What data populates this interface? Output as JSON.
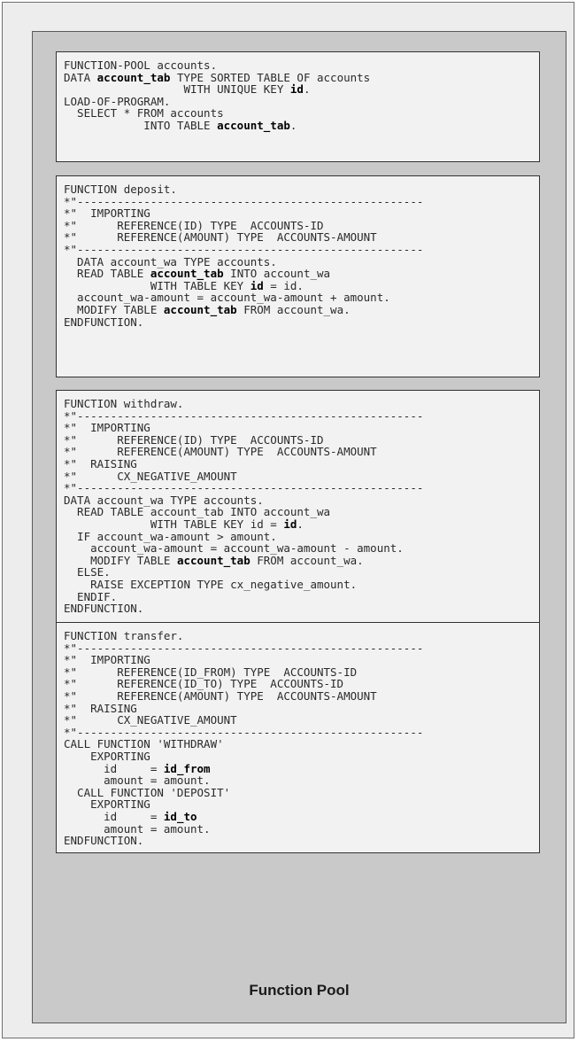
{
  "pool_label": "Function Pool",
  "blocks": [
    {
      "name": "function-pool-header",
      "lines": [
        [
          {
            "t": "FUNCTION-POOL accounts."
          }
        ],
        [
          {
            "t": "DATA "
          },
          {
            "t": "account_tab",
            "b": true
          },
          {
            "t": " TYPE SORTED TABLE OF accounts"
          }
        ],
        [
          {
            "t": "                  WITH UNIQUE KEY "
          },
          {
            "t": "id",
            "b": true
          },
          {
            "t": "."
          }
        ],
        [
          {
            "t": "LOAD-OF-PROGRAM."
          }
        ],
        [
          {
            "t": "  SELECT * FROM accounts"
          }
        ],
        [
          {
            "t": "            INTO TABLE "
          },
          {
            "t": "account_tab",
            "b": true
          },
          {
            "t": "."
          }
        ]
      ]
    },
    {
      "name": "function-deposit",
      "lines": [
        [
          {
            "t": "FUNCTION deposit."
          }
        ],
        [
          {
            "t": "*\"----------------------------------------------------"
          }
        ],
        [
          {
            "t": "*\"  IMPORTING"
          }
        ],
        [
          {
            "t": "*\"      REFERENCE(ID) TYPE  ACCOUNTS-ID"
          }
        ],
        [
          {
            "t": "*\"      REFERENCE(AMOUNT) TYPE  ACCOUNTS-AMOUNT"
          }
        ],
        [
          {
            "t": "*\"----------------------------------------------------"
          }
        ],
        [
          {
            "t": "  DATA account_wa TYPE accounts."
          }
        ],
        [
          {
            "t": "  READ TABLE "
          },
          {
            "t": "account_tab",
            "b": true
          },
          {
            "t": " INTO account_wa"
          }
        ],
        [
          {
            "t": "             WITH TABLE KEY "
          },
          {
            "t": "id",
            "b": true
          },
          {
            "t": " = id."
          }
        ],
        [
          {
            "t": "  account_wa-amount = account_wa-amount + amount."
          }
        ],
        [
          {
            "t": "  MODIFY TABLE "
          },
          {
            "t": "account_tab",
            "b": true
          },
          {
            "t": " FROM account_wa."
          }
        ],
        [
          {
            "t": "ENDFUNCTION."
          }
        ]
      ]
    },
    {
      "name": "function-withdraw",
      "lines": [
        [
          {
            "t": "FUNCTION withdraw."
          }
        ],
        [
          {
            "t": "*\"----------------------------------------------------"
          }
        ],
        [
          {
            "t": "*\"  IMPORTING"
          }
        ],
        [
          {
            "t": "*\"      REFERENCE(ID) TYPE  ACCOUNTS-ID"
          }
        ],
        [
          {
            "t": "*\"      REFERENCE(AMOUNT) TYPE  ACCOUNTS-AMOUNT"
          }
        ],
        [
          {
            "t": "*\"  RAISING"
          }
        ],
        [
          {
            "t": "*\"      CX_NEGATIVE_AMOUNT"
          }
        ],
        [
          {
            "t": "*\"----------------------------------------------------"
          }
        ],
        [
          {
            "t": "DATA account_wa TYPE accounts."
          }
        ],
        [
          {
            "t": "  READ TABLE account_tab INTO account_wa"
          }
        ],
        [
          {
            "t": "             WITH TABLE KEY id = "
          },
          {
            "t": "id",
            "b": true
          },
          {
            "t": "."
          }
        ],
        [
          {
            "t": "  IF account_wa-amount > amount."
          }
        ],
        [
          {
            "t": "    account_wa-amount = account_wa-amount - amount."
          }
        ],
        [
          {
            "t": "    MODIFY TABLE "
          },
          {
            "t": "account_tab",
            "b": true
          },
          {
            "t": " FROM account_wa."
          }
        ],
        [
          {
            "t": "  ELSE."
          }
        ],
        [
          {
            "t": "    RAISE EXCEPTION TYPE cx_negative_amount."
          }
        ],
        [
          {
            "t": "  ENDIF."
          }
        ],
        [
          {
            "t": "ENDFUNCTION."
          }
        ]
      ]
    },
    {
      "name": "function-transfer",
      "lines": [
        [
          {
            "t": "FUNCTION transfer."
          }
        ],
        [
          {
            "t": "*\"----------------------------------------------------"
          }
        ],
        [
          {
            "t": "*\"  IMPORTING"
          }
        ],
        [
          {
            "t": "*\"      REFERENCE(ID_FROM) TYPE  ACCOUNTS-ID"
          }
        ],
        [
          {
            "t": "*\"      REFERENCE(ID_TO) TYPE  ACCOUNTS-ID"
          }
        ],
        [
          {
            "t": "*\"      REFERENCE(AMOUNT) TYPE  ACCOUNTS-AMOUNT"
          }
        ],
        [
          {
            "t": "*\"  RAISING"
          }
        ],
        [
          {
            "t": "*\"      CX_NEGATIVE_AMOUNT"
          }
        ],
        [
          {
            "t": "*\"----------------------------------------------------"
          }
        ],
        [
          {
            "t": "CALL FUNCTION 'WITHDRAW'"
          }
        ],
        [
          {
            "t": "    EXPORTING"
          }
        ],
        [
          {
            "t": "      id     = "
          },
          {
            "t": "id_from",
            "b": true
          }
        ],
        [
          {
            "t": "      amount = amount."
          }
        ],
        [
          {
            "t": "  CALL FUNCTION 'DEPOSIT'"
          }
        ],
        [
          {
            "t": "    EXPORTING"
          }
        ],
        [
          {
            "t": "      id     = "
          },
          {
            "t": "id_to",
            "b": true
          }
        ],
        [
          {
            "t": "      amount = amount."
          }
        ],
        [
          {
            "t": "ENDFUNCTION."
          }
        ]
      ]
    }
  ]
}
